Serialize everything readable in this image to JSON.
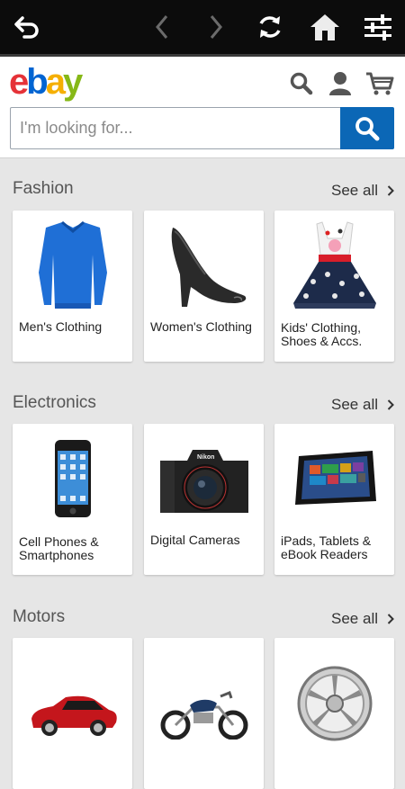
{
  "browser": {
    "icons": [
      "back-arrow-icon",
      "chevron-left-icon",
      "chevron-right-icon",
      "refresh-icon",
      "home-icon",
      "sliders-icon"
    ]
  },
  "header": {
    "logo": {
      "e": "e",
      "b": "b",
      "a": "a",
      "y": "y"
    },
    "search_placeholder": "I'm looking for..."
  },
  "sections": [
    {
      "title": "Fashion",
      "see_all": "See all",
      "items": [
        {
          "label": "Men's Clothing",
          "icon": "blue-sweater-icon"
        },
        {
          "label": "Women's Clothing",
          "icon": "high-heel-shoe-icon"
        },
        {
          "label": "Kids' Clothing, Shoes & Accs.",
          "icon": "kids-dress-icon"
        }
      ]
    },
    {
      "title": "Electronics",
      "see_all": "See all",
      "items": [
        {
          "label": "Cell Phones & Smartphones",
          "icon": "smartphone-icon"
        },
        {
          "label": "Digital Cameras",
          "icon": "dslr-camera-icon",
          "brand": "Nikon"
        },
        {
          "label": "iPads, Tablets & eBook Readers",
          "icon": "tablet-icon"
        }
      ]
    },
    {
      "title": "Motors",
      "see_all": "See all",
      "items": [
        {
          "label": "",
          "icon": "red-car-icon"
        },
        {
          "label": "",
          "icon": "motorcycle-icon"
        },
        {
          "label": "",
          "icon": "chrome-wheel-icon"
        }
      ]
    }
  ],
  "colors": {
    "ebay_e": "#e53238",
    "ebay_b": "#0064d2",
    "ebay_a": "#f5af02",
    "ebay_y": "#86b817",
    "search_button": "#0b67b6"
  }
}
